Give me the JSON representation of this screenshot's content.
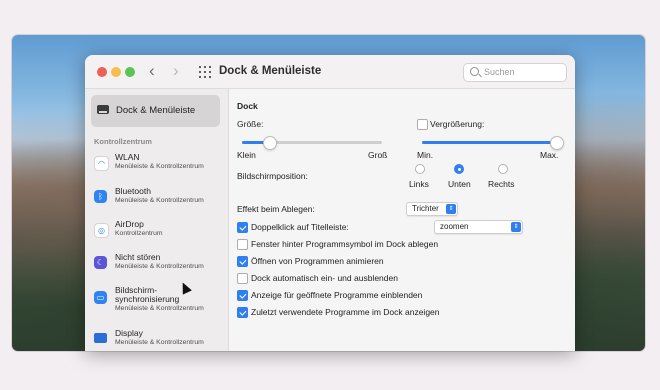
{
  "window": {
    "title": "Dock & Menüleiste"
  },
  "search": {
    "placeholder": "Suchen"
  },
  "sidebar": {
    "selected_label": "Dock & Menüleiste",
    "section_label": "Kontrollzentrum",
    "items": [
      {
        "title": "WLAN",
        "subtitle": "Menüleiste & Kontrollzentrum",
        "icon": "wifi-icon"
      },
      {
        "title": "Bluetooth",
        "subtitle": "Menüleiste & Kontrollzentrum",
        "icon": "bluetooth-icon"
      },
      {
        "title": "AirDrop",
        "subtitle": "Kontrollzentrum",
        "icon": "airdrop-icon"
      },
      {
        "title": "Nicht stören",
        "subtitle": "Menüleiste & Kontrollzentrum",
        "icon": "moon-icon"
      },
      {
        "title": "Bildschirm-",
        "title2": "synchronisierung",
        "subtitle": "Menüleiste & Kontrollzentrum",
        "icon": "screen-mirroring-icon"
      },
      {
        "title": "Display",
        "subtitle": "Menüleiste & Kontrollzentrum",
        "icon": "display-icon"
      }
    ]
  },
  "dock": {
    "header": "Dock",
    "size_label": "Größe:",
    "size_min": "Klein",
    "size_max": "Groß",
    "size_value": 0.19,
    "magnification_label": "Vergrößerung:",
    "magnification_checked": false,
    "magnification_min": "Min.",
    "magnification_max": "Max.",
    "magnification_value": 1.0,
    "position_label": "Bildschirmposition:",
    "positions": [
      "Links",
      "Unten",
      "Rechts"
    ],
    "position_selected": "Unten",
    "minimize_label": "Effekt beim Ablegen:",
    "minimize_value": "Trichter",
    "doubleclick_label": "Doppelklick auf Titelleiste:",
    "doubleclick_value": "zoomen",
    "checkboxes": [
      {
        "label": "Doppelklick auf Titelleiste:",
        "checked": true
      },
      {
        "label": "Fenster hinter Programmsymbol im Dock ablegen",
        "checked": false
      },
      {
        "label": "Öffnen von Programmen animieren",
        "checked": true
      },
      {
        "label": "Dock automatisch ein- und ausblenden",
        "checked": false
      },
      {
        "label": "Anzeige für geöffnete Programme einblenden",
        "checked": true
      },
      {
        "label": "Zuletzt verwendete Programme im Dock anzeigen",
        "checked": true
      }
    ]
  }
}
